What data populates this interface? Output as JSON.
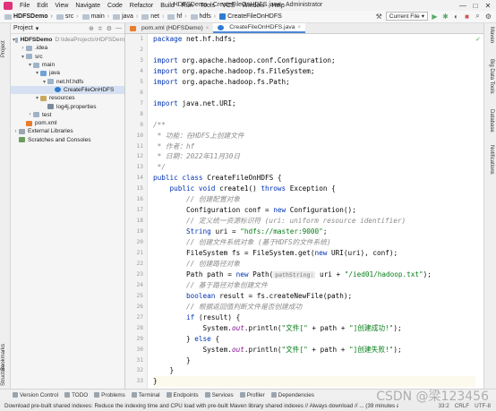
{
  "window": {
    "title": "HDFSDemo - CreateFileOnHDFS.java - Administrator",
    "controls": [
      "—",
      "□",
      "✕"
    ]
  },
  "menu": [
    "File",
    "Edit",
    "View",
    "Navigate",
    "Code",
    "Refactor",
    "Build",
    "Run",
    "Tools",
    "VCS",
    "Window",
    "Help"
  ],
  "breadcrumb": [
    "HDFSDemo",
    "src",
    "main",
    "java",
    "net",
    "hf",
    "hdfs",
    "CreateFileOnHDFS"
  ],
  "toolbar": {
    "run_config": "Current File"
  },
  "left_strip": {
    "top": "Project",
    "bottom1": "Bookmarks",
    "bottom2": "Structure"
  },
  "right_strip": [
    "Maven",
    "Big Data Tools",
    "Database",
    "Notifications"
  ],
  "project_panel": {
    "title": "Project",
    "tree": [
      {
        "indent": 0,
        "arrow": "▾",
        "icon": "folder",
        "label": "HDFSDemo",
        "extra": "D:\\IdeaProjects\\HDFSDem",
        "bold": true
      },
      {
        "indent": 1,
        "arrow": "›",
        "icon": "folder",
        "label": ".idea",
        "extra": ""
      },
      {
        "indent": 1,
        "arrow": "▾",
        "icon": "folder",
        "label": "src",
        "extra": ""
      },
      {
        "indent": 2,
        "arrow": "▾",
        "icon": "folder",
        "label": "main",
        "extra": ""
      },
      {
        "indent": 3,
        "arrow": "▾",
        "icon": "src-folder",
        "label": "java",
        "extra": ""
      },
      {
        "indent": 4,
        "arrow": "▾",
        "icon": "folder",
        "label": "net.hf.hdfs",
        "extra": ""
      },
      {
        "indent": 5,
        "arrow": "",
        "icon": "class",
        "label": "CreateFileOnHDFS",
        "extra": "",
        "selected": true
      },
      {
        "indent": 3,
        "arrow": "▾",
        "icon": "res-folder",
        "label": "resources",
        "extra": ""
      },
      {
        "indent": 4,
        "arrow": "",
        "icon": "props",
        "label": "log4j.properties",
        "extra": ""
      },
      {
        "indent": 2,
        "arrow": "›",
        "icon": "folder",
        "label": "test",
        "extra": ""
      },
      {
        "indent": 1,
        "arrow": "",
        "icon": "xml",
        "label": "pom.xml",
        "extra": ""
      },
      {
        "indent": 0,
        "arrow": "›",
        "icon": "lib",
        "label": "External Libraries",
        "extra": ""
      },
      {
        "indent": 0,
        "arrow": "",
        "icon": "scratch",
        "label": "Scratches and Consoles",
        "extra": ""
      }
    ]
  },
  "tabs": [
    {
      "label": "pom.xml (HDFSDemo)",
      "active": false
    },
    {
      "label": "CreateFileOnHDFS.java",
      "active": true
    }
  ],
  "line_numbers": [
    "1",
    "2",
    "3",
    "4",
    "5",
    "6",
    "7",
    "8",
    "9",
    "10",
    "11",
    "12",
    "13",
    "14",
    "15",
    "16",
    "17",
    "18",
    "19",
    "20",
    "21",
    "22",
    "23",
    "24",
    "25",
    "26",
    "27",
    "28",
    "29",
    "30",
    "31",
    "32",
    "33"
  ],
  "code": [
    [
      [
        "kw",
        "package"
      ],
      [
        "",
        "net.hf.hdfs;"
      ]
    ],
    [],
    [
      [
        "kw",
        "import"
      ],
      [
        "",
        "org.apache.hadoop.conf.Configuration;"
      ]
    ],
    [
      [
        "kw",
        "import"
      ],
      [
        "",
        "org.apache.hadoop.fs.FileSystem;"
      ]
    ],
    [
      [
        "kw",
        "import"
      ],
      [
        "",
        "org.apache.hadoop.fs.Path;"
      ]
    ],
    [],
    [
      [
        "kw",
        "import"
      ],
      [
        "",
        "java.net.URI;"
      ]
    ],
    [],
    [
      [
        "cm",
        "/**"
      ]
    ],
    [
      [
        "cm",
        " * 功能：在HDFS上创建文件"
      ]
    ],
    [
      [
        "cm",
        " * 作者：hf"
      ]
    ],
    [
      [
        "cm",
        " * 日期：2022年11月30日"
      ]
    ],
    [
      [
        "cm",
        " */"
      ]
    ],
    [
      [
        "kw",
        "public class"
      ],
      [
        "",
        "CreateFileOnHDFS {"
      ]
    ],
    [
      [
        "",
        "    "
      ],
      [
        "kw",
        "public void"
      ],
      [
        "",
        "create1() "
      ],
      [
        "kw",
        "throws"
      ],
      [
        "",
        "Exception {"
      ]
    ],
    [
      [
        "cm",
        "        // 创建配置对象"
      ]
    ],
    [
      [
        "",
        "        Configuration conf = "
      ],
      [
        "kw",
        "new"
      ],
      [
        "",
        "Configuration();"
      ]
    ],
    [
      [
        "cm",
        "        // 定义统一资源标识符 (uri: uniform resource identifier)"
      ]
    ],
    [
      [
        "",
        "        "
      ],
      [
        "kw",
        "String"
      ],
      [
        "",
        "uri = "
      ],
      [
        "st",
        "\"hdfs://master:9000\""
      ],
      [
        "",
        ";"
      ]
    ],
    [
      [
        "cm",
        "        // 创建文件系统对象 (基于HDFS的文件系统)"
      ]
    ],
    [
      [
        "",
        "        FileSystem fs = FileSystem.get("
      ],
      [
        "kw",
        "new"
      ],
      [
        "",
        "URI(uri), conf);"
      ]
    ],
    [
      [
        "cm",
        "        // 创建路径对象"
      ]
    ],
    [
      [
        "",
        "        Path path = "
      ],
      [
        "kw",
        "new"
      ],
      [
        "",
        "Path("
      ],
      [
        "hint",
        "pathString:"
      ],
      [
        "",
        "uri + "
      ],
      [
        "st",
        "\"/ied01/hadoop.txt\""
      ],
      [
        "",
        ");"
      ]
    ],
    [
      [
        "cm",
        "        // 基于路径对象创建文件"
      ]
    ],
    [
      [
        "",
        "        "
      ],
      [
        "kw",
        "boolean"
      ],
      [
        "",
        "result = fs.createNewFile(path);"
      ]
    ],
    [
      [
        "cm",
        "        // 根据返回值判断文件是否创建成功"
      ]
    ],
    [
      [
        "",
        "        "
      ],
      [
        "kw",
        "if"
      ],
      [
        "",
        "(result) {"
      ]
    ],
    [
      [
        "",
        "            System."
      ],
      [
        "fn",
        "out"
      ],
      [
        "",
        ".println("
      ],
      [
        "st",
        "\"文件[\""
      ],
      [
        "",
        " + path + "
      ],
      [
        "st",
        "\"]创建成功!\""
      ],
      [
        "",
        ");"
      ]
    ],
    [
      [
        "",
        "        } "
      ],
      [
        "kw",
        "else"
      ],
      [
        "",
        "{"
      ]
    ],
    [
      [
        "",
        "            System."
      ],
      [
        "fn",
        "out"
      ],
      [
        "",
        ".println("
      ],
      [
        "st",
        "\"文件[\""
      ],
      [
        "",
        " + path + "
      ],
      [
        "st",
        "\"]创建失败!\""
      ],
      [
        "",
        ");"
      ]
    ],
    [
      [
        "",
        "        }"
      ]
    ],
    [
      [
        "",
        "    }"
      ]
    ],
    [
      [
        "",
        "}"
      ]
    ]
  ],
  "bottom_tools": [
    "Version Control",
    "TODO",
    "Problems",
    "Terminal",
    "Endpoints",
    "Services",
    "Profiler",
    "Dependencies"
  ],
  "status": {
    "message": "Download pre-built shared indexes: Reduce the indexing time and CPU load with pre-built Maven library shared indexes // Always download // ... (39 minutes ago)",
    "position": "33:2",
    "line_sep": "CRLF",
    "encoding": "UTF-8",
    "watermark": "CSDN @梁123456"
  }
}
